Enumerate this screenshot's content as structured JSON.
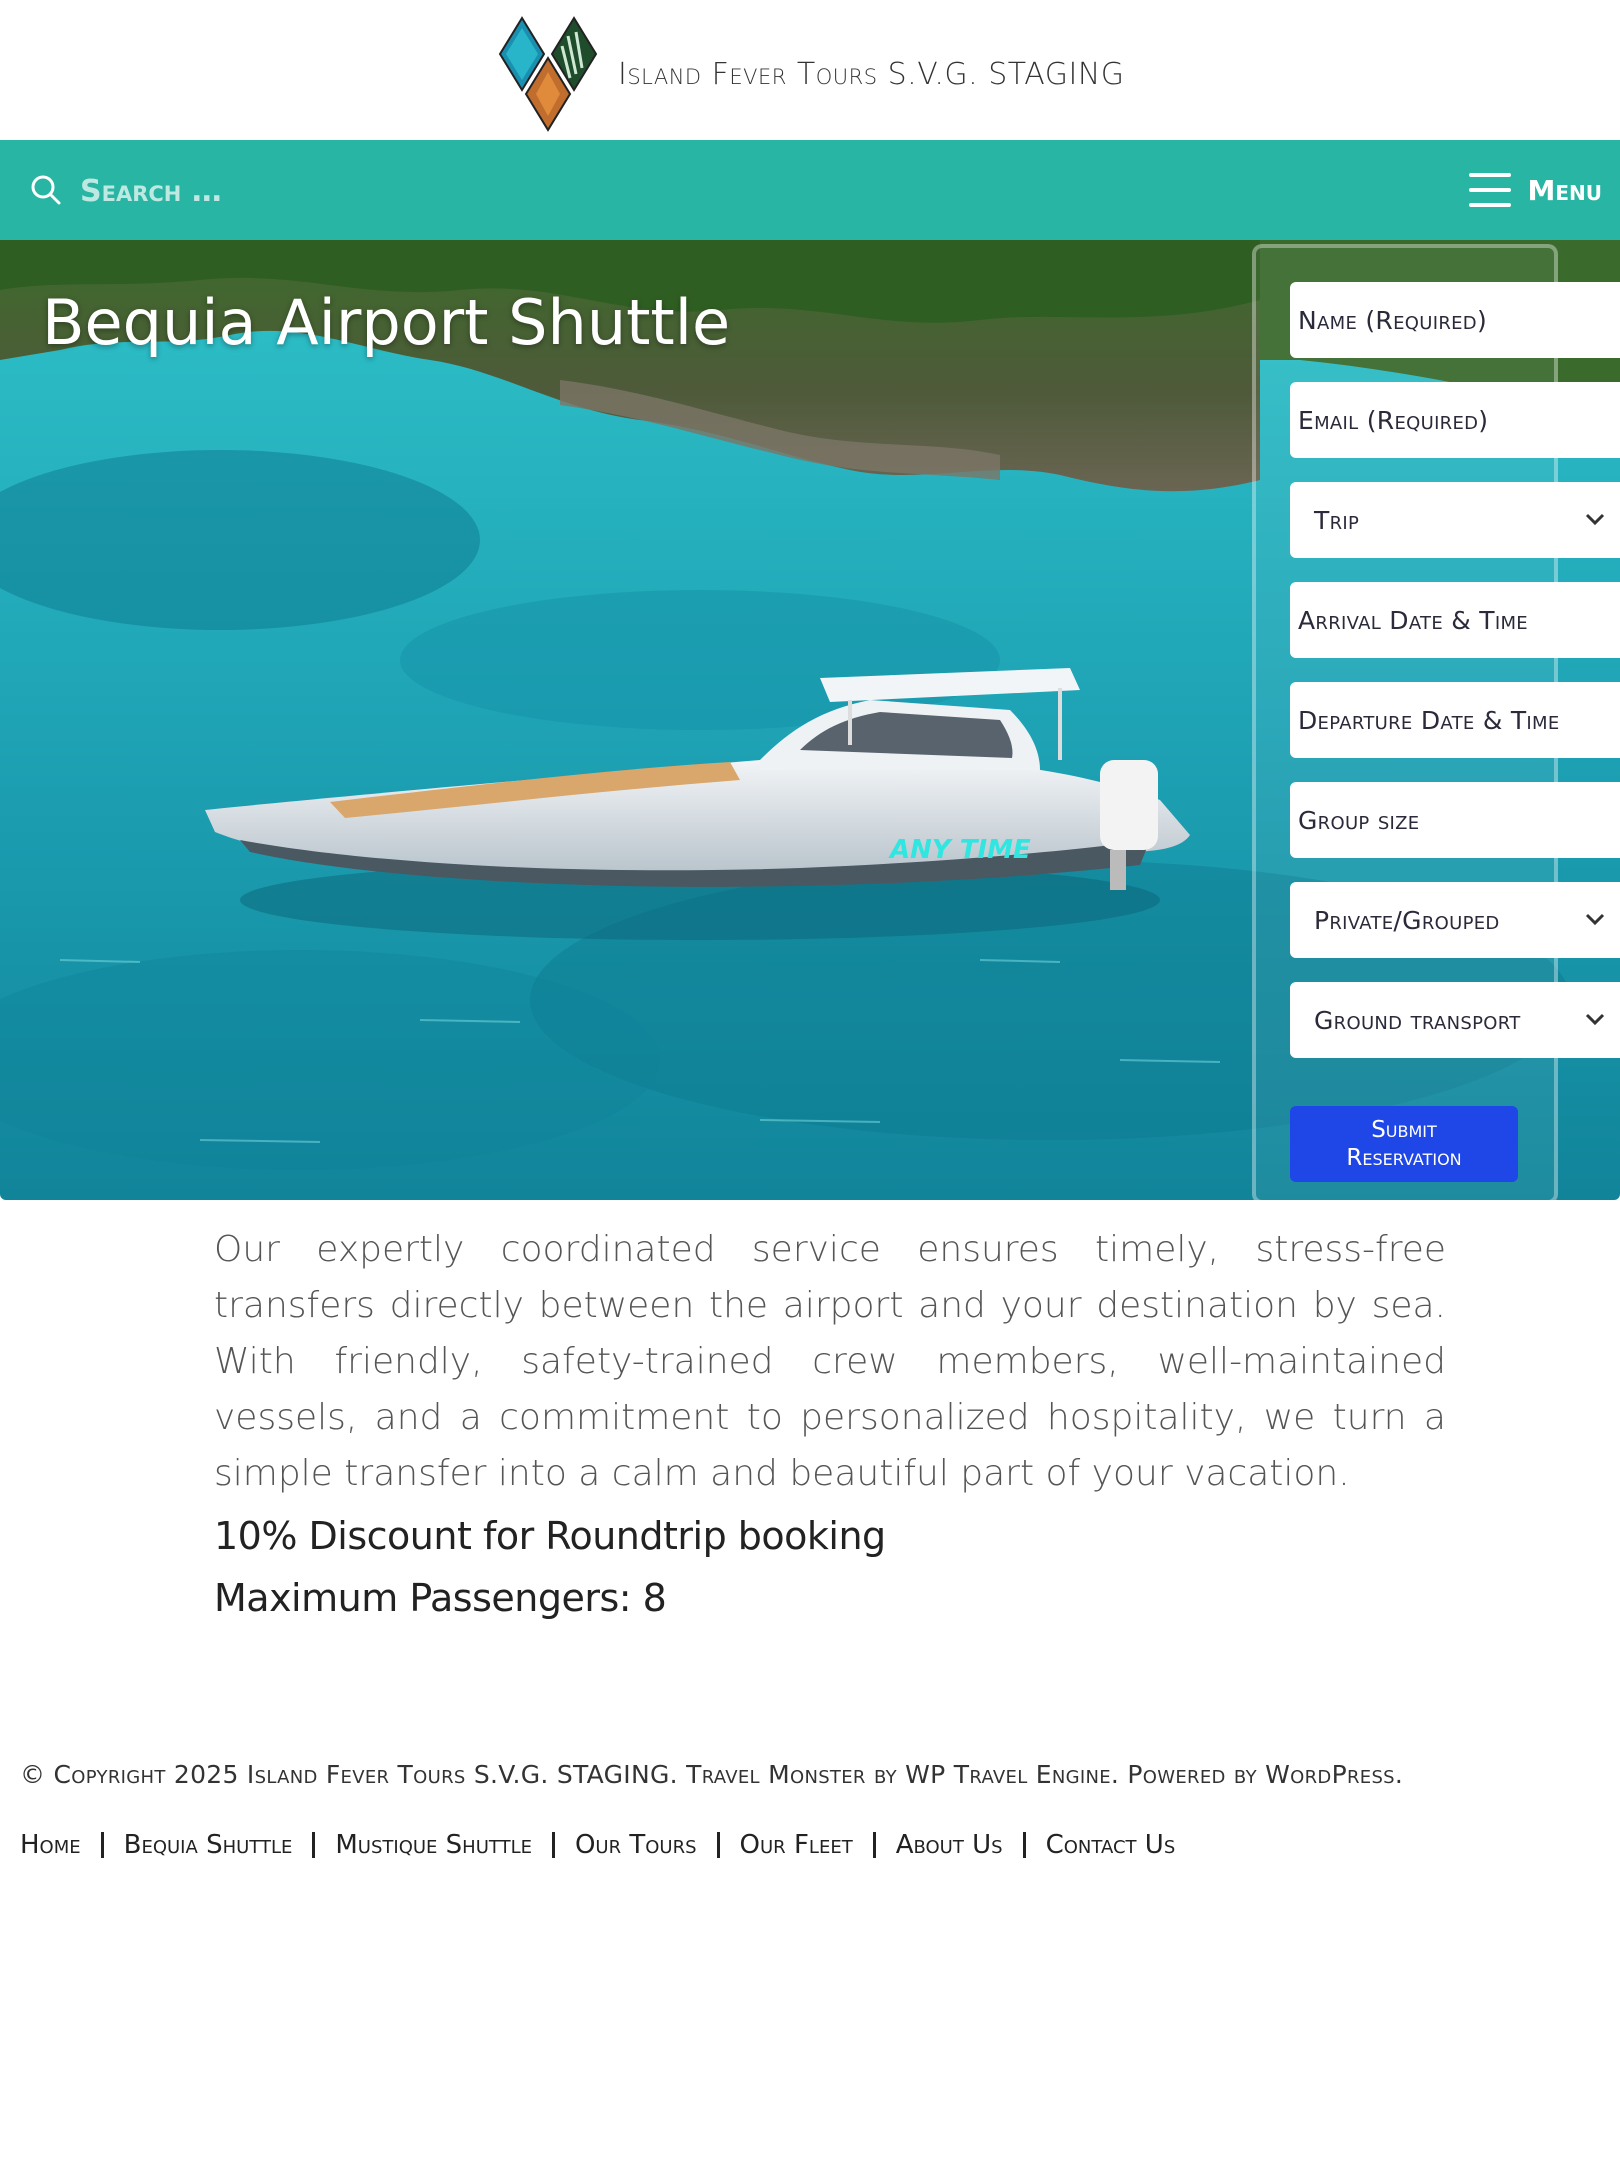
{
  "site": {
    "title": "Island Fever Tours S.V.G. STAGING"
  },
  "navbar": {
    "search_placeholder": "Search …",
    "menu_label": "Menu"
  },
  "hero": {
    "title": "Bequia Airport Shuttle",
    "boat_name": "ANY TIME"
  },
  "form": {
    "name_placeholder": "Name (Required)",
    "email_placeholder": "Email (Required)",
    "trip_selected": "Trip",
    "arrival_placeholder": "Arrival Date & Time",
    "departure_placeholder": "Departure Date & Time",
    "group_size_placeholder": "Group size",
    "private_grouped_selected": "Private/Grouped",
    "ground_transport_selected": "Ground transport",
    "submit_line1": "Submit",
    "submit_line2": "Reservation"
  },
  "content": {
    "description": "Our expertly coordinated service ensures timely, stress-free transfers directly between the airport and your destination by sea. With friendly, safety-trained crew members, well-maintained vessels, and a commitment to personalized hospitality, we turn a simple transfer into a calm and beautiful part of your vacation.",
    "discount": "10% Discount for Roundtrip booking",
    "max_passengers": "Maximum Passengers: 8"
  },
  "footer": {
    "copyright": "© Copyright 2025 Island Fever Tours S.V.G. STAGING. Travel Monster by WP Travel Engine. Powered by WordPress.",
    "nav": [
      {
        "label": "Home"
      },
      {
        "label": "Bequia Shuttle"
      },
      {
        "label": "Mustique Shuttle"
      },
      {
        "label": "Our Tours"
      },
      {
        "label": "Our Fleet"
      },
      {
        "label": "About Us"
      },
      {
        "label": "Contact Us"
      }
    ]
  },
  "colors": {
    "navbar": "#29b5a3",
    "submit_button": "#1f46e6",
    "water": "#1ea9b8"
  },
  "icons": [
    "logo-diamonds",
    "search-icon",
    "hamburger-icon",
    "chevron-down-icon"
  ]
}
